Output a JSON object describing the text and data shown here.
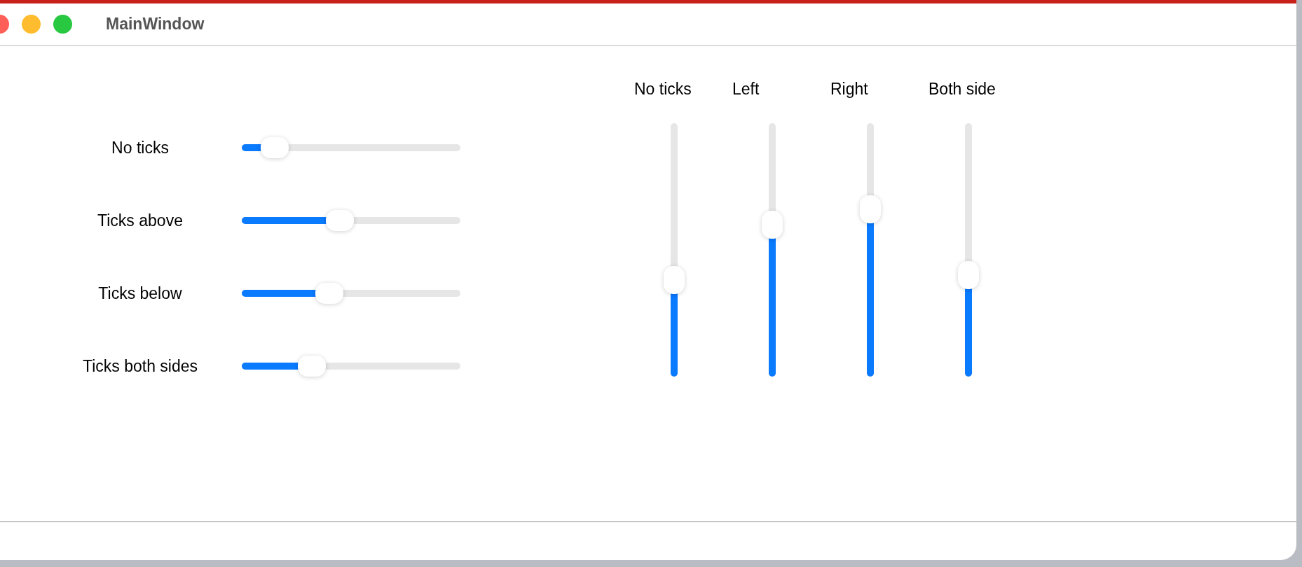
{
  "window": {
    "title": "MainWindow"
  },
  "horizontal_sliders": [
    {
      "label": "No ticks",
      "level": 0.15
    },
    {
      "label": "Ticks above",
      "level": 0.45
    },
    {
      "label": "Ticks below",
      "level": 0.4
    },
    {
      "label": "Ticks both sides",
      "level": 0.32
    }
  ],
  "vertical_sliders": [
    {
      "label": "No ticks",
      "level": 0.38
    },
    {
      "label": "Left",
      "level": 0.6
    },
    {
      "label": "Right",
      "level": 0.66
    },
    {
      "label": "Both side",
      "level": 0.4
    }
  ]
}
